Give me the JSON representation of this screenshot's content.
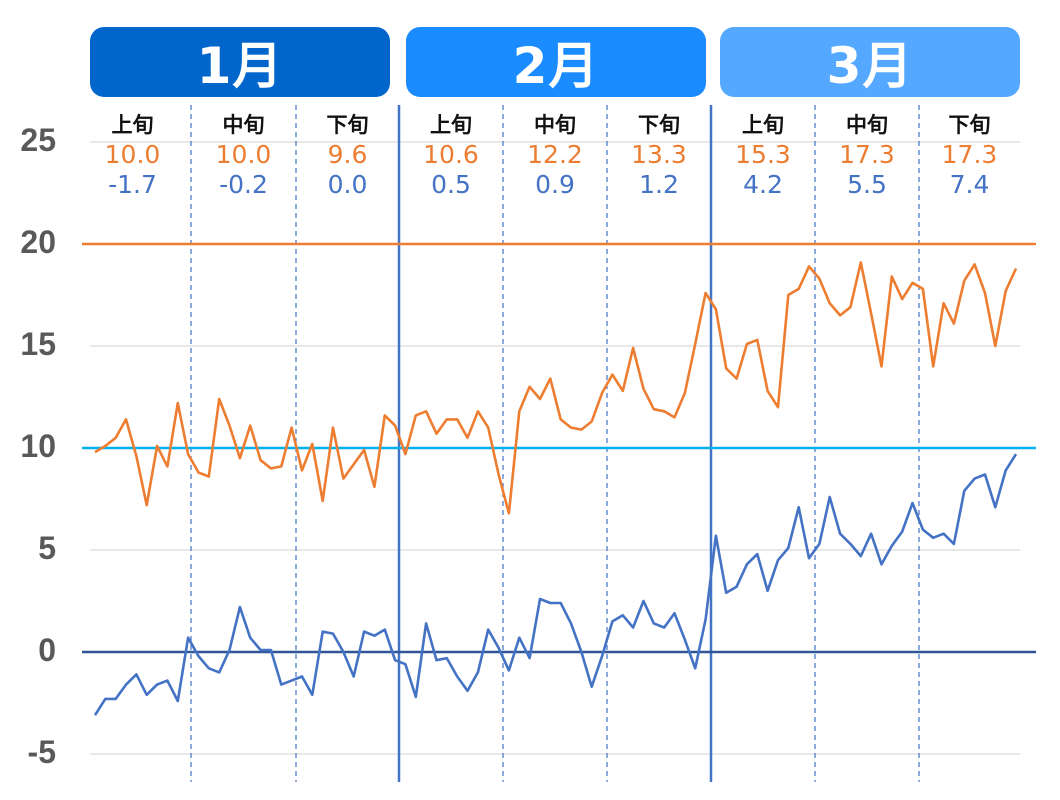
{
  "chart_data": {
    "type": "line",
    "title": "",
    "xlabel": "",
    "ylabel": "",
    "ylim": [
      -5,
      25
    ],
    "yticks": [
      "25",
      "20",
      "15",
      "10",
      "5",
      "0",
      "-5"
    ],
    "ytick_values": [
      25,
      20,
      15,
      10,
      5,
      0,
      -5
    ],
    "grid": true,
    "months": [
      {
        "label": "1月",
        "color": "#0066CC",
        "days": 31
      },
      {
        "label": "2月",
        "color": "#1A8CFF",
        "days": 28
      },
      {
        "label": "3月",
        "color": "#55A8FF",
        "days": 31
      }
    ],
    "decades": [
      {
        "label": "上旬",
        "max_avg": "10.0",
        "min_avg": "-1.7"
      },
      {
        "label": "中旬",
        "max_avg": "10.0",
        "min_avg": "-0.2"
      },
      {
        "label": "下旬",
        "max_avg": "9.6",
        "min_avg": "0.0"
      },
      {
        "label": "上旬",
        "max_avg": "10.6",
        "min_avg": "0.5"
      },
      {
        "label": "中旬",
        "max_avg": "12.2",
        "min_avg": "0.9"
      },
      {
        "label": "下旬",
        "max_avg": "13.3",
        "min_avg": "1.2"
      },
      {
        "label": "上旬",
        "max_avg": "15.3",
        "min_avg": "4.2"
      },
      {
        "label": "中旬",
        "max_avg": "17.3",
        "min_avg": "5.5"
      },
      {
        "label": "下旬",
        "max_avg": "17.3",
        "min_avg": "7.4"
      }
    ],
    "reference_lines": [
      {
        "name": "20-degree line",
        "value": 20,
        "color": "#ED7D31"
      },
      {
        "name": "10-degree line",
        "value": 10,
        "color": "#00B0F0"
      },
      {
        "name": "0-degree line",
        "value": 0,
        "color": "#2F5597"
      }
    ],
    "series": [
      {
        "name": "daily max temperature",
        "color": "#ED7D31",
        "values": [
          9.8,
          10.1,
          10.5,
          11.4,
          9.6,
          7.2,
          10.1,
          9.1,
          12.2,
          9.7,
          8.8,
          8.6,
          12.4,
          11.1,
          9.5,
          11.1,
          9.4,
          9.0,
          9.1,
          11.0,
          8.9,
          10.2,
          7.4,
          11.0,
          8.5,
          9.2,
          9.9,
          8.1,
          11.6,
          11.1,
          9.7,
          11.6,
          11.8,
          10.7,
          11.4,
          11.4,
          10.5,
          11.8,
          11.0,
          8.7,
          6.8,
          11.8,
          13.0,
          12.4,
          13.4,
          11.4,
          11.0,
          10.9,
          11.3,
          12.7,
          13.6,
          12.8,
          14.9,
          12.9,
          11.9,
          11.8,
          11.5,
          12.7,
          15.1,
          17.6,
          16.8,
          13.9,
          13.4,
          15.1,
          15.3,
          12.8,
          12.0,
          17.5,
          17.8,
          18.9,
          18.3,
          17.1,
          16.5,
          16.9,
          19.1,
          16.6,
          14.0,
          18.4,
          17.3,
          18.1,
          17.8,
          14.0,
          17.1,
          16.1,
          18.2,
          19.0,
          17.6,
          15.0,
          17.7,
          18.8
        ]
      },
      {
        "name": "daily min temperature",
        "color": "#4472C4",
        "values": [
          -3.1,
          -2.3,
          -2.3,
          -1.6,
          -1.1,
          -2.1,
          -1.6,
          -1.4,
          -2.4,
          0.7,
          -0.2,
          -0.8,
          -1.0,
          0.1,
          2.2,
          0.7,
          0.1,
          0.1,
          -1.6,
          -1.4,
          -1.2,
          -2.1,
          1.0,
          0.9,
          0.0,
          -1.2,
          1.0,
          0.8,
          1.1,
          -0.4,
          -0.6,
          -2.2,
          1.4,
          -0.4,
          -0.3,
          -1.2,
          -1.9,
          -1.0,
          1.1,
          0.2,
          -0.9,
          0.7,
          -0.3,
          2.6,
          2.4,
          2.4,
          1.4,
          0.0,
          -1.7,
          -0.2,
          1.5,
          1.8,
          1.2,
          2.5,
          1.4,
          1.2,
          1.9,
          0.6,
          -0.8,
          1.6,
          5.7,
          2.9,
          3.2,
          4.3,
          4.8,
          3.0,
          4.5,
          5.1,
          7.1,
          4.6,
          5.3,
          7.6,
          5.8,
          5.3,
          4.7,
          5.8,
          4.3,
          5.2,
          5.9,
          7.3,
          6.0,
          5.6,
          5.8,
          5.3,
          7.9,
          8.5,
          8.7,
          7.1,
          8.9,
          9.7
        ]
      }
    ]
  }
}
